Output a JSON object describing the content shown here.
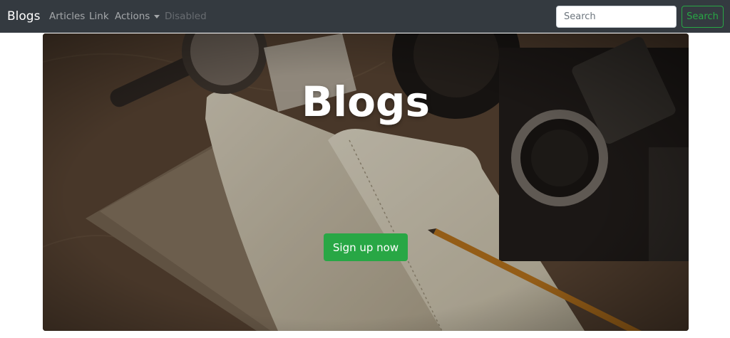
{
  "navbar": {
    "brand": "Blogs",
    "links": {
      "articles": "Articles",
      "link": "Link",
      "actions": "Actions",
      "disabled": "Disabled"
    },
    "search": {
      "placeholder": "Search",
      "button_label": "Search"
    }
  },
  "hero": {
    "title": "Blogs",
    "cta_label": "Sign up now"
  },
  "colors": {
    "navbar_bg": "#343a40",
    "success": "#28a745",
    "hero_overlay": "#3b2e22"
  },
  "icons": {
    "actions_caret": "chevron-down-icon"
  }
}
